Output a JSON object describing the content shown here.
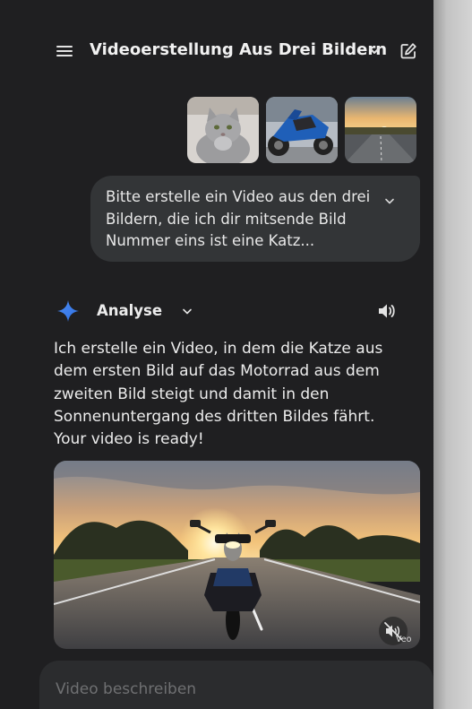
{
  "header": {
    "title": "Videoerstellung Aus Drei Bildern",
    "menu_icon": "hamburger-menu-icon",
    "title_dropdown_icon": "chevron-down-icon",
    "new_chat_icon": "edit-square-icon"
  },
  "user_message": {
    "attachments": [
      {
        "name": "cat-image"
      },
      {
        "name": "motorcycle-image"
      },
      {
        "name": "sunset-road-image"
      }
    ],
    "text": "Bitte erstelle ein Video aus den drei Bildern, die ich dir mitsende Bild Nummer eins ist eine Katz...",
    "expand_icon": "chevron-down-icon"
  },
  "assistant": {
    "icon": "sparkle-icon",
    "model_label": "Analyse",
    "model_dropdown_icon": "chevron-down-icon",
    "speaker_icon": "speaker-icon",
    "response_text": "Ich erstelle ein Video, in dem die Katze aus dem ersten Bild auf das Motorrad aus dem zweiten Bild steigt und damit in den Sonnenuntergang des dritten Bildes fährt. Your video is ready!",
    "video": {
      "watermark": "Veo",
      "mute_icon": "volume-off-icon"
    }
  },
  "composer": {
    "placeholder": "Video beschreiben"
  },
  "colors": {
    "background": "#1f1f21",
    "bubble": "#333537",
    "accent": "#4c8df6"
  }
}
